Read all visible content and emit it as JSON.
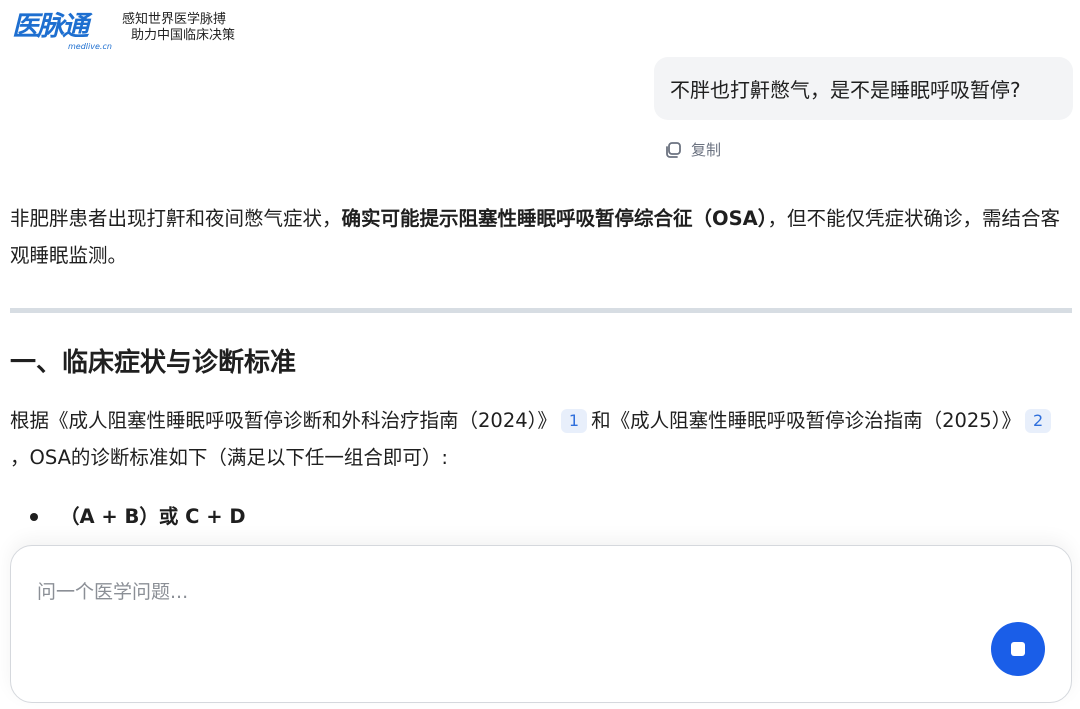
{
  "brand": {
    "logo_text": "医脉通",
    "logo_sub": "medlive.cn",
    "slogan_line1": "感知世界医学脉搏",
    "slogan_line2": "助力中国临床决策"
  },
  "chat": {
    "user_message": "不胖也打鼾憋气，是不是睡眠呼吸暂停?",
    "copy_label": "复制"
  },
  "answer": {
    "intro_pre": "非肥胖患者出现打鼾和夜间憋气症状，",
    "intro_bold": "确实可能提示阻塞性睡眠呼吸暂停综合征（OSA）",
    "intro_post": "，但不能仅凭症状确诊，需结合客观睡眠监测。",
    "section_title": "一、临床症状与诊断标准",
    "para_part1": "根据《成人阻塞性睡眠呼吸暂停诊断和外科治疗指南（2024）》",
    "cite1": "1",
    "para_part2": "和《成人阻塞性睡眠呼吸暂停诊治指南（2025）》",
    "cite2": "2",
    "para_part3": "，OSA的诊断标准如下（满足以下任一组合即可）:",
    "bullet1": "（A + B）或 C + D"
  },
  "composer": {
    "placeholder": "问一个医学问题..."
  },
  "colors": {
    "accent": "#1a5ee8",
    "brand_blue": "#1e6fd0",
    "bubble_bg": "#f3f4f6",
    "citation_bg": "#e8effb"
  },
  "icons": {
    "copy": "copy-icon",
    "stop": "stop-icon"
  }
}
